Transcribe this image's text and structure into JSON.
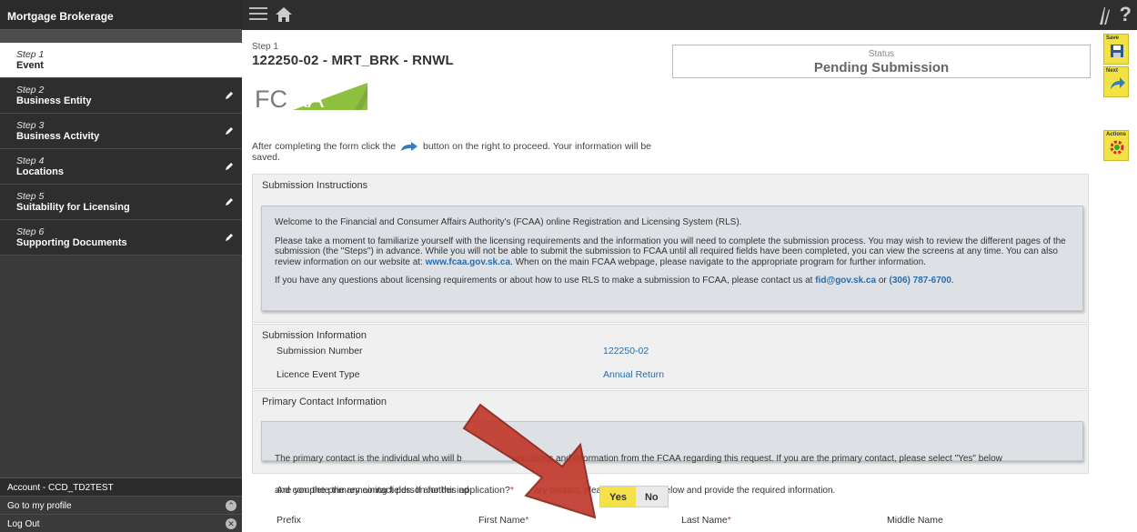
{
  "sidebar": {
    "title": "Mortgage Brokerage",
    "steps": [
      {
        "num": "Step 1",
        "title": "Event"
      },
      {
        "num": "Step 2",
        "title": "Business Entity"
      },
      {
        "num": "Step 3",
        "title": "Business Activity"
      },
      {
        "num": "Step 4",
        "title": "Locations"
      },
      {
        "num": "Step 5",
        "title": "Suitability for Licensing"
      },
      {
        "num": "Step 6",
        "title": "Supporting Documents"
      }
    ],
    "account": "Account - CCD_TD2TEST",
    "profile_link": "Go to my profile",
    "logout_link": "Log Out"
  },
  "topbar": {
    "help": "?"
  },
  "rail": {
    "save_label": "Save",
    "next_label": "Next",
    "actions_label": "Actions"
  },
  "main": {
    "step_label": "Step 1",
    "title": "122250-02 - MRT_BRK - RNWL",
    "status_label": "Status",
    "status_value": "Pending Submission",
    "logo_text": "FCAA",
    "instruction_before": "After completing the form click the",
    "instruction_after": "button on the right to proceed. Your information will be saved."
  },
  "submission_instructions": {
    "heading": "Submission Instructions",
    "p1": "Welcome to the Financial and Consumer Affairs Authority's (FCAA) online Registration and Licensing System (RLS).",
    "p2a": "Please take a moment to familiarize yourself with the licensing requirements and the information you will need to complete the submission process. You may wish to review the different pages of the submission (the \"Steps\") in advance. While you will not be able to submit the submission to FCAA until all required fields have been completed, you can view the screens at any time. You can also review information on our website at:",
    "website": "www.fcaa.gov.sk.ca",
    "p2b": ". When on the main FCAA webpage, please navigate to the appropriate program for further information.",
    "p3a": "If you have any questions about licensing requirements or about how to use RLS to make a submission to FCAA, please contact us at",
    "email": "fid@gov.sk.ca",
    "p3or": "or",
    "phone": "(306) 787-6700",
    "p3end": "."
  },
  "submission_information": {
    "heading": "Submission Information",
    "number_label": "Submission Number",
    "number_value": "122250-02",
    "event_label": "Licence Event Type",
    "event_value": "Annual Return"
  },
  "primary_contact": {
    "heading": "Primary Contact Information",
    "info_line1": "The primary contact is the individual who will b                    unications and information from the FCAA regarding this request. If you are the primary contact, please select \"Yes\" below",
    "info_line2": "and complete the remaining fields. If another ind                          ary contact, please select \"No\" below and provide the required information.",
    "question": "Are you the primary contact person for this application?",
    "required_mark": "*",
    "yes": "Yes",
    "no": "No",
    "prefix_label": "Prefix",
    "first_name_label": "First Name",
    "last_name_label": "Last Name",
    "middle_name_label": "Middle Name"
  },
  "colors": {
    "accent_yellow": "#f5e24a",
    "link_blue": "#2a6ca8",
    "annotation_red": "#c0392b"
  }
}
